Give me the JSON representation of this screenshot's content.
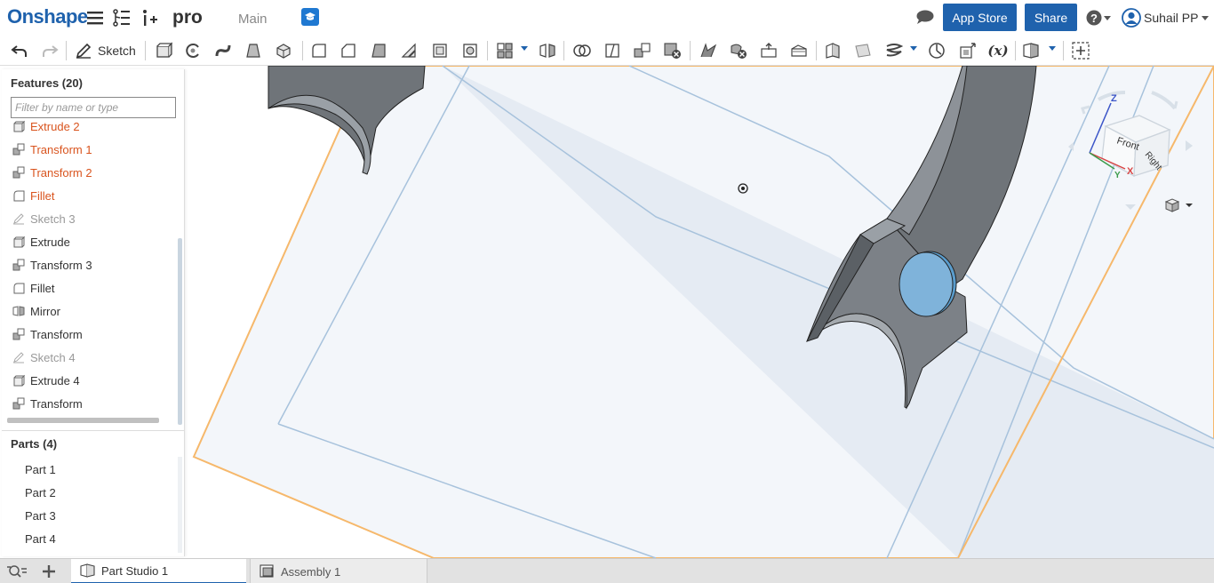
{
  "header": {
    "logo": "Onshape",
    "document_name": "pro",
    "workspace": "Main",
    "app_store_label": "App Store",
    "share_label": "Share",
    "user_name": "Suhail PP"
  },
  "toolbar": {
    "sketch_label": "Sketch",
    "variable_label": "(x)"
  },
  "features_panel": {
    "title": "Features (20)",
    "filter_placeholder": "Filter by name or type",
    "items": [
      {
        "label": "Extrude 2",
        "state": "error",
        "icon": "extrude-icon"
      },
      {
        "label": "Transform 1",
        "state": "error",
        "icon": "transform-icon"
      },
      {
        "label": "Transform 2",
        "state": "error",
        "icon": "transform-icon"
      },
      {
        "label": "Fillet",
        "state": "error",
        "icon": "fillet-icon"
      },
      {
        "label": "Sketch 3",
        "state": "hidden",
        "icon": "sketch-icon"
      },
      {
        "label": "Extrude",
        "state": "normal",
        "icon": "extrude-icon"
      },
      {
        "label": "Transform 3",
        "state": "normal",
        "icon": "transform-icon"
      },
      {
        "label": "Fillet",
        "state": "normal",
        "icon": "fillet-icon"
      },
      {
        "label": "Mirror",
        "state": "normal",
        "icon": "mirror-icon"
      },
      {
        "label": "Transform",
        "state": "normal",
        "icon": "transform-icon"
      },
      {
        "label": "Sketch 4",
        "state": "hidden",
        "icon": "sketch-icon"
      },
      {
        "label": "Extrude 4",
        "state": "normal",
        "icon": "extrude-icon"
      },
      {
        "label": "Transform",
        "state": "normal",
        "icon": "transform-icon"
      }
    ]
  },
  "parts_panel": {
    "title": "Parts (4)",
    "items": [
      "Part 1",
      "Part 2",
      "Part 3",
      "Part 4"
    ]
  },
  "viewcube": {
    "front_label": "Front",
    "right_label": "Right",
    "axis_z": "Z",
    "axis_y": "Y",
    "axis_x": "X"
  },
  "bottom_tabs": [
    {
      "label": "Part Studio 1",
      "active": true
    },
    {
      "label": "Assembly 1",
      "active": false
    }
  ],
  "colors": {
    "brand_blue": "#1f62ad",
    "error_text": "#d9541e",
    "hidden_text": "#999999",
    "plane_edge_orange": "#f6b86b",
    "plane_edge_blue": "#a7c2dc",
    "part_gray": "#6f7479",
    "selected_part": "#5a9ccc"
  }
}
